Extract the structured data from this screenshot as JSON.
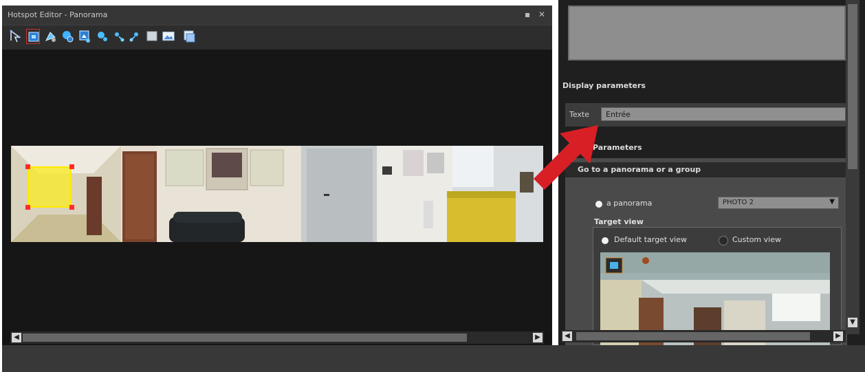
{
  "editor": {
    "title": "Hotspot Editor - Panorama",
    "pin_glyph": "▪",
    "close_glyph": "✕",
    "toolbar_icons": [
      "select-icon",
      "polygon-icon",
      "add-point-icon",
      "add-hotspot-icon",
      "image-hotspot-icon",
      "move-point-icon",
      "add-vertex-icon",
      "remove-vertex-icon",
      "rectangle-icon",
      "photo-icon",
      "copy-view-icon"
    ]
  },
  "props": {
    "display_header": "Display parameters",
    "tooltip_label": "Texte",
    "tooltip_value": "Entrée",
    "params_header": "Parameters",
    "goto_label": "Go to a panorama or a group",
    "radio_panorama_label": "a panorama",
    "panorama_select_value": "PHOTO 2",
    "target_view_label": "Target view",
    "default_view_label": "Default target view",
    "custom_view_label": "Custom view"
  },
  "colors": {
    "accent_arrow": "#d81f26",
    "hotspot_fill": "#f6e63a",
    "panel_dark": "#151515"
  }
}
